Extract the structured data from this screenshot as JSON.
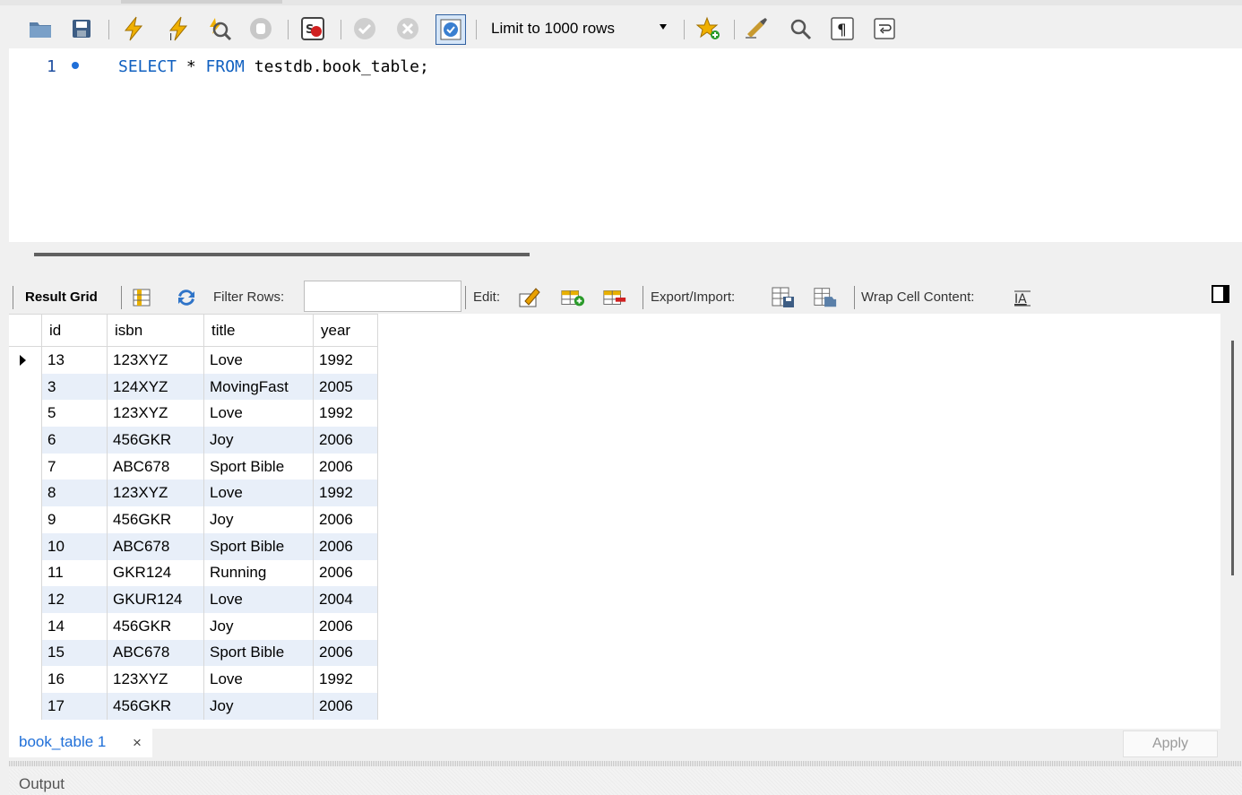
{
  "toolbar": {
    "limit_label": "Limit to 1000 rows",
    "icons": [
      "open-folder-icon",
      "save-icon",
      "execute-icon",
      "execute-current-icon",
      "explain-icon",
      "stop-icon",
      "toggle-error-icon",
      "commit-icon",
      "rollback-icon",
      "autocommit-icon",
      "bookmark-star-icon",
      "beautify-icon",
      "find-icon",
      "invisible-chars-icon",
      "wrap-lines-icon"
    ]
  },
  "editor": {
    "line_number": "1",
    "kw_select": "SELECT",
    "star": " * ",
    "kw_from": "FROM",
    "target": " testdb.book_table;"
  },
  "result_toolbar": {
    "result_grid_label": "Result Grid",
    "filter_label": "Filter Rows:",
    "filter_value": "",
    "edit_label": "Edit:",
    "export_label": "Export/Import:",
    "wrap_label": "Wrap Cell Content:"
  },
  "grid": {
    "columns": [
      "id",
      "isbn",
      "title",
      "year"
    ],
    "rows": [
      [
        "13",
        "123XYZ",
        "Love",
        "1992"
      ],
      [
        "3",
        "124XYZ",
        "MovingFast",
        "2005"
      ],
      [
        "5",
        "123XYZ",
        "Love",
        "1992"
      ],
      [
        "6",
        "456GKR",
        "Joy",
        "2006"
      ],
      [
        "7",
        "ABC678",
        "Sport Bible",
        "2006"
      ],
      [
        "8",
        "123XYZ",
        "Love",
        "1992"
      ],
      [
        "9",
        "456GKR",
        "Joy",
        "2006"
      ],
      [
        "10",
        "ABC678",
        "Sport Bible",
        "2006"
      ],
      [
        "11",
        "GKR124",
        "Running",
        "2006"
      ],
      [
        "12",
        "GKUR124",
        "Love",
        "2004"
      ],
      [
        "14",
        "456GKR",
        "Joy",
        "2006"
      ],
      [
        "15",
        "ABC678",
        "Sport Bible",
        "2006"
      ],
      [
        "16",
        "123XYZ",
        "Love",
        "1992"
      ],
      [
        "17",
        "456GKR",
        "Joy",
        "2006"
      ]
    ]
  },
  "bottom": {
    "tab_label": "book_table 1",
    "tab_close": "×",
    "apply_label": "Apply",
    "output_label": "Output"
  }
}
